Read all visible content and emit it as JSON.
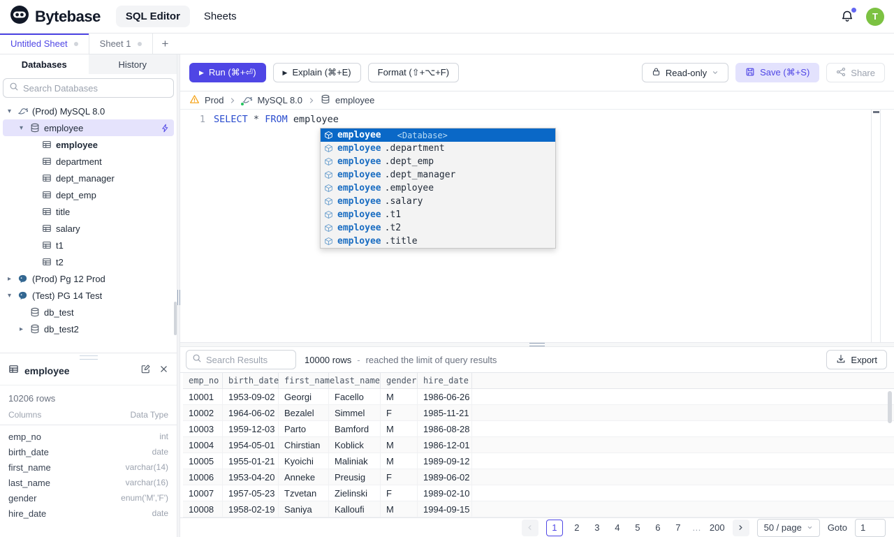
{
  "colors": {
    "accent": "#4f46e5",
    "selection_blue": "#0a68c7",
    "keyword_blue": "#2a4cce",
    "avatar_green": "#7cc242",
    "warning_amber": "#f59e0b",
    "status_green": "#22c55e",
    "pg_blue": "#336791"
  },
  "topbar": {
    "brand": "Bytebase",
    "nav": [
      {
        "label": "SQL Editor"
      },
      {
        "label": "Sheets"
      }
    ],
    "avatar": "T"
  },
  "sheet_tabs": {
    "tabs": [
      {
        "label": "Untitled Sheet"
      },
      {
        "label": "Sheet 1"
      }
    ],
    "add": "+"
  },
  "sidebar": {
    "tabs": [
      {
        "label": "Databases"
      },
      {
        "label": "History"
      }
    ],
    "search_placeholder": "Search Databases",
    "tree": [
      {
        "label": "(Prod) MySQL 8.0",
        "icon": "mysql",
        "caret": "down",
        "level": 0
      },
      {
        "label": "employee",
        "icon": "database",
        "caret": "down",
        "level": 1,
        "selected": true,
        "action": "lightning"
      },
      {
        "label": "employee",
        "icon": "table",
        "level": 2,
        "bold": true
      },
      {
        "label": "department",
        "icon": "table",
        "level": 2
      },
      {
        "label": "dept_manager",
        "icon": "table",
        "level": 2
      },
      {
        "label": "dept_emp",
        "icon": "table",
        "level": 2
      },
      {
        "label": "title",
        "icon": "table",
        "level": 2
      },
      {
        "label": "salary",
        "icon": "table",
        "level": 2
      },
      {
        "label": "t1",
        "icon": "table",
        "level": 2
      },
      {
        "label": "t2",
        "icon": "table",
        "level": 2
      },
      {
        "label": "(Prod) Pg 12 Prod",
        "icon": "pg",
        "caret": "right",
        "level": 0
      },
      {
        "label": "(Test) PG 14 Test",
        "icon": "pg",
        "caret": "down",
        "level": 0
      },
      {
        "label": "db_test",
        "icon": "database",
        "level": 1
      },
      {
        "label": "db_test2",
        "icon": "database",
        "caret": "right",
        "level": 1
      }
    ]
  },
  "toolbar": {
    "run": "Run (⌘+⏎)",
    "explain": "Explain (⌘+E)",
    "format": "Format (⇧+⌥+F)",
    "read_only": "Read-only",
    "save": "Save (⌘+S)",
    "share": "Share"
  },
  "breadcrumb": {
    "environment": "Prod",
    "instance": "MySQL 8.0",
    "database": "employee"
  },
  "editor": {
    "line_number": "1",
    "keyword_select": "SELECT",
    "star": "*",
    "keyword_from": "FROM",
    "table_ref": "employee",
    "query": "SELECT * FROM employee"
  },
  "autocomplete": {
    "items": [
      {
        "label": "employee",
        "detail": "<Database>",
        "selected": true
      },
      {
        "prefix": "employee",
        "rest": ".department"
      },
      {
        "prefix": "employee",
        "rest": ".dept_emp"
      },
      {
        "prefix": "employee",
        "rest": ".dept_manager"
      },
      {
        "prefix": "employee",
        "rest": ".employee"
      },
      {
        "prefix": "employee",
        "rest": ".salary"
      },
      {
        "prefix": "employee",
        "rest": ".t1"
      },
      {
        "prefix": "employee",
        "rest": ".t2"
      },
      {
        "prefix": "employee",
        "rest": ".title"
      }
    ]
  },
  "results": {
    "search_placeholder": "Search Results",
    "row_count": "10000 rows",
    "separator": "-",
    "limit_note": "reached the limit of query results",
    "export_label": "Export",
    "columns": [
      "emp_no",
      "birth_date",
      "first_name",
      "last_name",
      "gender",
      "hire_date"
    ],
    "rows": [
      [
        "10001",
        "1953-09-02",
        "Georgi",
        "Facello",
        "M",
        "1986-06-26"
      ],
      [
        "10002",
        "1964-06-02",
        "Bezalel",
        "Simmel",
        "F",
        "1985-11-21"
      ],
      [
        "10003",
        "1959-12-03",
        "Parto",
        "Bamford",
        "M",
        "1986-08-28"
      ],
      [
        "10004",
        "1954-05-01",
        "Chirstian",
        "Koblick",
        "M",
        "1986-12-01"
      ],
      [
        "10005",
        "1955-01-21",
        "Kyoichi",
        "Maliniak",
        "M",
        "1989-09-12"
      ],
      [
        "10006",
        "1953-04-20",
        "Anneke",
        "Preusig",
        "F",
        "1989-06-02"
      ],
      [
        "10007",
        "1957-05-23",
        "Tzvetan",
        "Zielinski",
        "F",
        "1989-02-10"
      ],
      [
        "10008",
        "1958-02-19",
        "Saniya",
        "Kalloufi",
        "M",
        "1994-09-15"
      ]
    ]
  },
  "table_panel": {
    "title": "employee",
    "row_count": "10206 rows",
    "columns_label": "Columns",
    "type_label": "Data Type",
    "fields": [
      {
        "name": "emp_no",
        "type": "int"
      },
      {
        "name": "birth_date",
        "type": "date"
      },
      {
        "name": "first_name",
        "type": "varchar(14)"
      },
      {
        "name": "last_name",
        "type": "varchar(16)"
      },
      {
        "name": "gender",
        "type": "enum('M','F')"
      },
      {
        "name": "hire_date",
        "type": "date"
      }
    ]
  },
  "pagination": {
    "pages": [
      "1",
      "2",
      "3",
      "4",
      "5",
      "6",
      "7",
      "…",
      "200"
    ],
    "active_page": "1",
    "page_size": "50 / page",
    "goto_label": "Goto",
    "goto_value": "1"
  }
}
